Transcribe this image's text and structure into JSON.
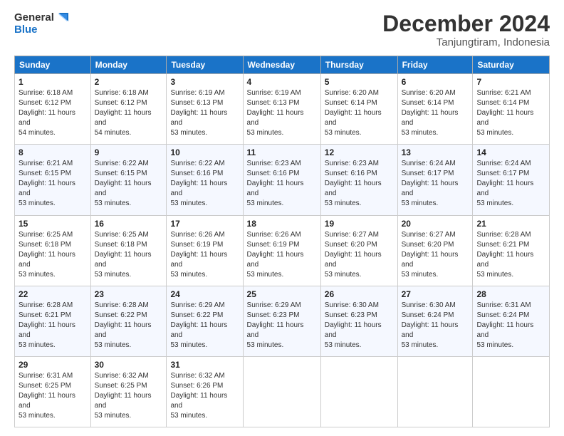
{
  "logo": {
    "line1": "General",
    "line2": "Blue"
  },
  "title": "December 2024",
  "subtitle": "Tanjungtiram, Indonesia",
  "days_of_week": [
    "Sunday",
    "Monday",
    "Tuesday",
    "Wednesday",
    "Thursday",
    "Friday",
    "Saturday"
  ],
  "weeks": [
    [
      {
        "day": "1",
        "sunrise": "6:18 AM",
        "sunset": "6:12 PM",
        "daylight": "11 hours and 54 minutes."
      },
      {
        "day": "2",
        "sunrise": "6:18 AM",
        "sunset": "6:12 PM",
        "daylight": "11 hours and 54 minutes."
      },
      {
        "day": "3",
        "sunrise": "6:19 AM",
        "sunset": "6:13 PM",
        "daylight": "11 hours and 53 minutes."
      },
      {
        "day": "4",
        "sunrise": "6:19 AM",
        "sunset": "6:13 PM",
        "daylight": "11 hours and 53 minutes."
      },
      {
        "day": "5",
        "sunrise": "6:20 AM",
        "sunset": "6:14 PM",
        "daylight": "11 hours and 53 minutes."
      },
      {
        "day": "6",
        "sunrise": "6:20 AM",
        "sunset": "6:14 PM",
        "daylight": "11 hours and 53 minutes."
      },
      {
        "day": "7",
        "sunrise": "6:21 AM",
        "sunset": "6:14 PM",
        "daylight": "11 hours and 53 minutes."
      }
    ],
    [
      {
        "day": "8",
        "sunrise": "6:21 AM",
        "sunset": "6:15 PM",
        "daylight": "11 hours and 53 minutes."
      },
      {
        "day": "9",
        "sunrise": "6:22 AM",
        "sunset": "6:15 PM",
        "daylight": "11 hours and 53 minutes."
      },
      {
        "day": "10",
        "sunrise": "6:22 AM",
        "sunset": "6:16 PM",
        "daylight": "11 hours and 53 minutes."
      },
      {
        "day": "11",
        "sunrise": "6:23 AM",
        "sunset": "6:16 PM",
        "daylight": "11 hours and 53 minutes."
      },
      {
        "day": "12",
        "sunrise": "6:23 AM",
        "sunset": "6:16 PM",
        "daylight": "11 hours and 53 minutes."
      },
      {
        "day": "13",
        "sunrise": "6:24 AM",
        "sunset": "6:17 PM",
        "daylight": "11 hours and 53 minutes."
      },
      {
        "day": "14",
        "sunrise": "6:24 AM",
        "sunset": "6:17 PM",
        "daylight": "11 hours and 53 minutes."
      }
    ],
    [
      {
        "day": "15",
        "sunrise": "6:25 AM",
        "sunset": "6:18 PM",
        "daylight": "11 hours and 53 minutes."
      },
      {
        "day": "16",
        "sunrise": "6:25 AM",
        "sunset": "6:18 PM",
        "daylight": "11 hours and 53 minutes."
      },
      {
        "day": "17",
        "sunrise": "6:26 AM",
        "sunset": "6:19 PM",
        "daylight": "11 hours and 53 minutes."
      },
      {
        "day": "18",
        "sunrise": "6:26 AM",
        "sunset": "6:19 PM",
        "daylight": "11 hours and 53 minutes."
      },
      {
        "day": "19",
        "sunrise": "6:27 AM",
        "sunset": "6:20 PM",
        "daylight": "11 hours and 53 minutes."
      },
      {
        "day": "20",
        "sunrise": "6:27 AM",
        "sunset": "6:20 PM",
        "daylight": "11 hours and 53 minutes."
      },
      {
        "day": "21",
        "sunrise": "6:28 AM",
        "sunset": "6:21 PM",
        "daylight": "11 hours and 53 minutes."
      }
    ],
    [
      {
        "day": "22",
        "sunrise": "6:28 AM",
        "sunset": "6:21 PM",
        "daylight": "11 hours and 53 minutes."
      },
      {
        "day": "23",
        "sunrise": "6:28 AM",
        "sunset": "6:22 PM",
        "daylight": "11 hours and 53 minutes."
      },
      {
        "day": "24",
        "sunrise": "6:29 AM",
        "sunset": "6:22 PM",
        "daylight": "11 hours and 53 minutes."
      },
      {
        "day": "25",
        "sunrise": "6:29 AM",
        "sunset": "6:23 PM",
        "daylight": "11 hours and 53 minutes."
      },
      {
        "day": "26",
        "sunrise": "6:30 AM",
        "sunset": "6:23 PM",
        "daylight": "11 hours and 53 minutes."
      },
      {
        "day": "27",
        "sunrise": "6:30 AM",
        "sunset": "6:24 PM",
        "daylight": "11 hours and 53 minutes."
      },
      {
        "day": "28",
        "sunrise": "6:31 AM",
        "sunset": "6:24 PM",
        "daylight": "11 hours and 53 minutes."
      }
    ],
    [
      {
        "day": "29",
        "sunrise": "6:31 AM",
        "sunset": "6:25 PM",
        "daylight": "11 hours and 53 minutes."
      },
      {
        "day": "30",
        "sunrise": "6:32 AM",
        "sunset": "6:25 PM",
        "daylight": "11 hours and 53 minutes."
      },
      {
        "day": "31",
        "sunrise": "6:32 AM",
        "sunset": "6:26 PM",
        "daylight": "11 hours and 53 minutes."
      },
      null,
      null,
      null,
      null
    ]
  ],
  "labels": {
    "sunrise": "Sunrise:",
    "sunset": "Sunset:",
    "daylight": "Daylight:"
  }
}
